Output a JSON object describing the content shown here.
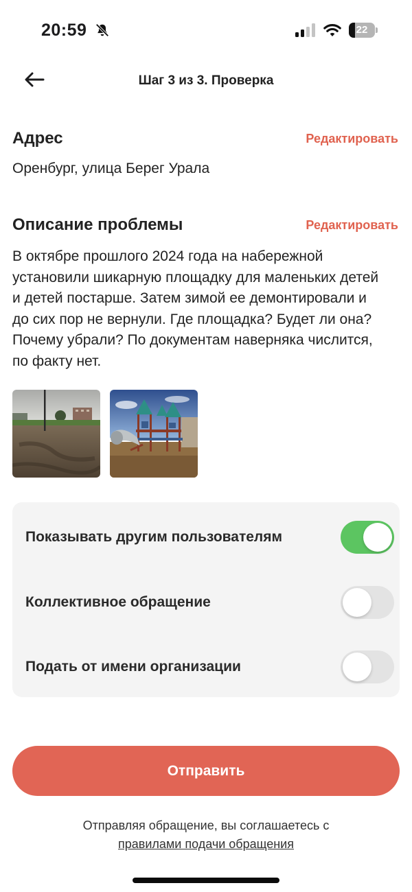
{
  "status_bar": {
    "time": "20:59",
    "battery_level": "22",
    "icons": [
      "bell-slash-icon",
      "signal-icon",
      "wifi-icon",
      "battery-icon"
    ]
  },
  "header": {
    "back_icon": "arrow-left-icon",
    "title": "Шаг 3 из 3. Проверка"
  },
  "address": {
    "title": "Адрес",
    "edit_label": "Редактировать",
    "value": "Оренбург, улица Берег Урала"
  },
  "description": {
    "title": "Описание проблемы",
    "edit_label": "Редактировать",
    "text": "В октябре прошлого 2024 года на набережной установили шикарную площадку для маленьких детей и детей постарше. Затем зимой ее демонтировали и до сих пор не вернули. Где площадка? Будет ли она? Почему убрали? По документам наверняка числится, по факту нет."
  },
  "photos": [
    {
      "name": "photo-empty-lot"
    },
    {
      "name": "photo-playground"
    }
  ],
  "settings": [
    {
      "label": "Показывать другим пользователям",
      "enabled": true
    },
    {
      "label": "Коллективное обращение",
      "enabled": false
    },
    {
      "label": "Подать от имени организации",
      "enabled": false
    }
  ],
  "submit_label": "Отправить",
  "footer": {
    "agreement_text": "Отправляя обращение, вы соглашаетесь с",
    "rules_link": "правилами подачи обращения"
  },
  "colors": {
    "accent": "#e16555",
    "edit_link": "#e0624f",
    "toggle_on": "#5cc561",
    "toggle_off": "#e3e3e3",
    "card_background": "#f4f4f4"
  }
}
